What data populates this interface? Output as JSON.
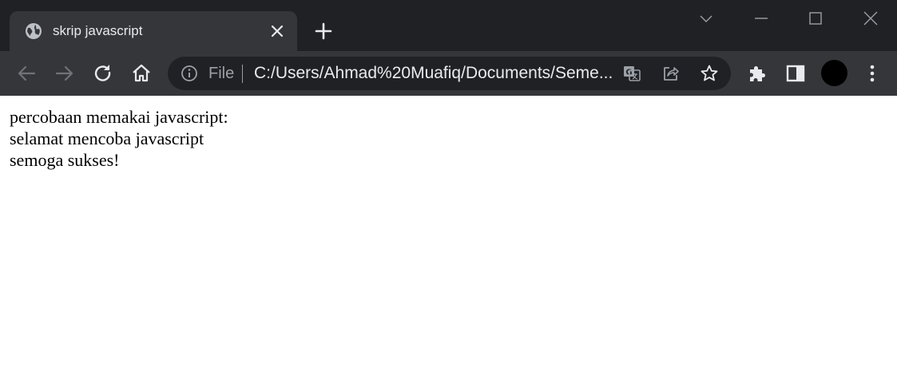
{
  "tab": {
    "title": "skrip javascript",
    "favicon": "globe-icon"
  },
  "toolbar": {
    "back_icon": "back-arrow-icon",
    "forward_icon": "forward-arrow-icon",
    "reload_icon": "reload-icon",
    "home_icon": "home-icon",
    "extensions_icon": "puzzle-icon",
    "side_panel_icon": "side-panel-icon",
    "menu_icon": "kebab-menu-icon"
  },
  "omnibox": {
    "scheme_label": "File",
    "url": "C:/Users/Ahmad%20Muafiq/Documents/Seme...",
    "translate_icon": "translate-icon",
    "share_icon": "share-icon",
    "bookmark_icon": "star-icon"
  },
  "window_controls": [
    "chevron-down-icon",
    "minimize-icon",
    "maximize-icon",
    "close-icon"
  ],
  "page": {
    "lines": [
      "percobaan memakai javascript:",
      "selamat mencoba javascript",
      "semoga sukses!"
    ]
  },
  "colors": {
    "tabstrip_bg": "#202124",
    "toolbar_bg": "#35363a",
    "omnibox_bg": "#202124",
    "text_light": "#e8eaed",
    "text_dim": "#9aa0a6"
  }
}
